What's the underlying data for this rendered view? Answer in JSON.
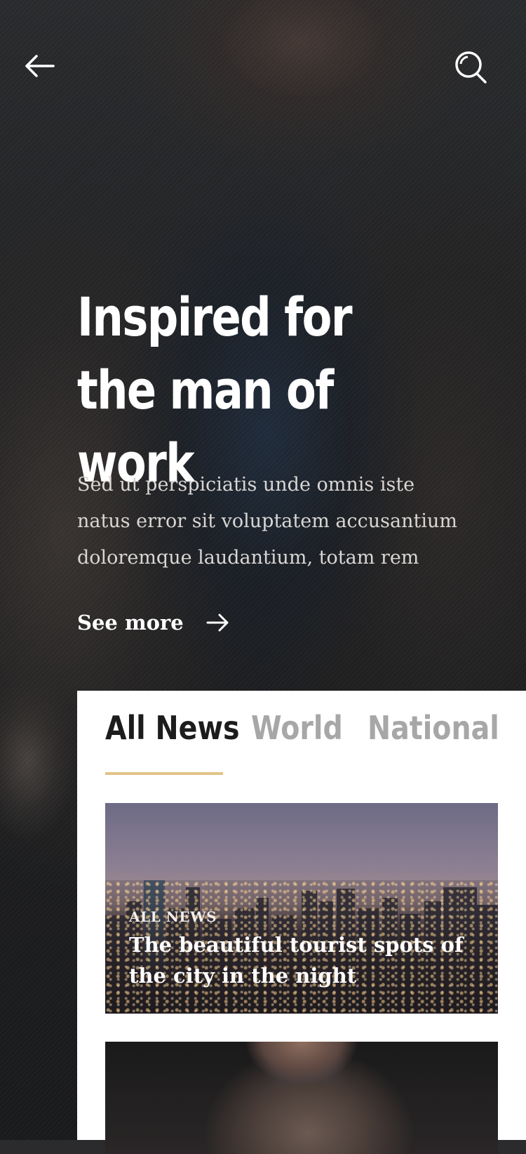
{
  "hero": {
    "title_line1": "Inspired for",
    "title_line2": "the man of work",
    "body": "Sed ut perspiciatis unde omnis iste natus error sit voluptatem accusantium doloremque laudantium, totam rem",
    "see_more_label": "See more"
  },
  "header": {
    "back_icon": "arrow-left-icon",
    "search_icon": "search-icon"
  },
  "tabs": [
    {
      "label": "All News",
      "active": true
    },
    {
      "label": "World",
      "active": false
    },
    {
      "label": "National",
      "active": false
    }
  ],
  "cards": [
    {
      "category": "ALL NEWS",
      "title": "The beautiful tourist spots of the city in the night"
    }
  ],
  "colors": {
    "accent": "#e2c389",
    "tab_active": "#1c1c1c",
    "tab_inactive": "#a7a7a7"
  }
}
